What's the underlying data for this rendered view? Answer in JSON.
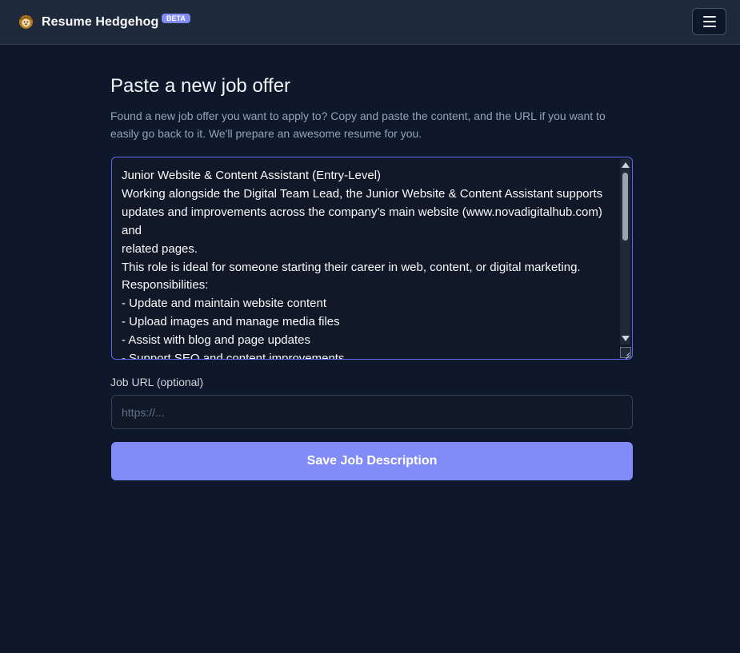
{
  "app": {
    "name": "Resume Hedgehog",
    "badge": "BETA",
    "logo_icon": "hedgehog-icon",
    "menu_icon": "hamburger-menu-icon"
  },
  "page": {
    "title": "Paste a new job offer",
    "description": "Found a new job offer you want to apply to? Copy and paste the content, and the URL if you want to easily go back to it. We'll prepare an awesome resume for you."
  },
  "job_description": {
    "value": "Junior Website & Content Assistant (Entry-Level)\nWorking alongside the Digital Team Lead, the Junior Website & Content Assistant supports updates and improvements across the company’s main website (www.novadigitalhub.com)\nand\nrelated pages.\nThis role is ideal for someone starting their career in web, content, or digital marketing.\nResponsibilities:\n- Update and maintain website content\n- Upload images and manage media files\n- Assist with blog and page updates\n- Support SEO and content improvements"
  },
  "job_url": {
    "label": "Job URL (optional)",
    "placeholder": "https://...",
    "value": ""
  },
  "save_button": {
    "label": "Save Job Description"
  },
  "colors": {
    "background": "#0f172a",
    "navbar": "#1e293b",
    "accent": "#818cf8",
    "focus_border": "#6366f1"
  }
}
